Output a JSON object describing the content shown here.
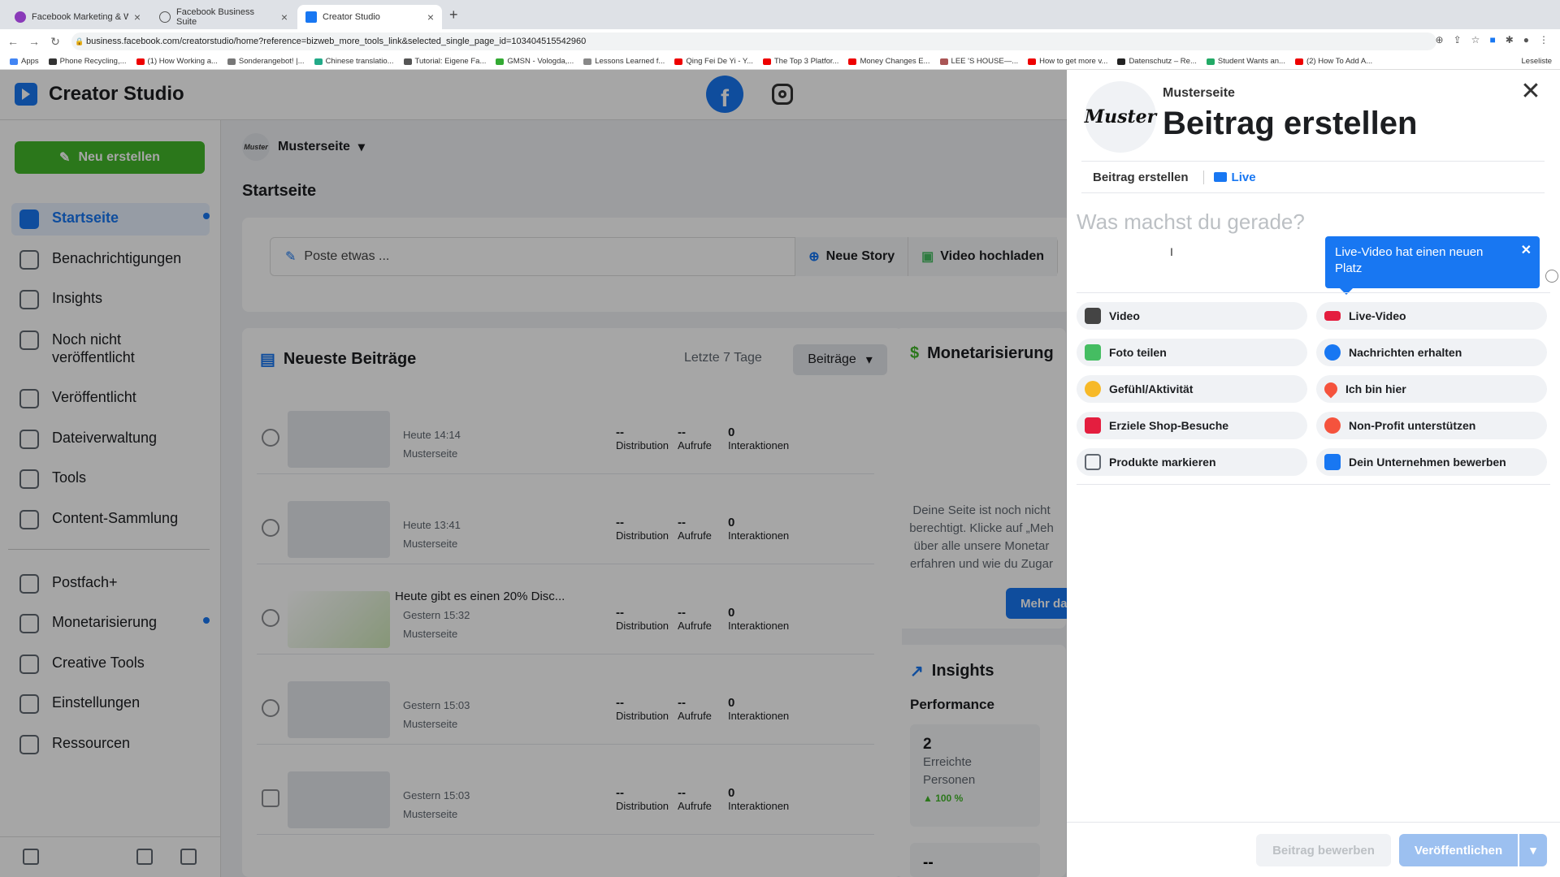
{
  "browser": {
    "tabs": [
      {
        "label": "Facebook Marketing & Werbe...",
        "active": false
      },
      {
        "label": "Facebook Business Suite",
        "active": false
      },
      {
        "label": "Creator Studio",
        "active": true
      }
    ],
    "url": "business.facebook.com/creatorstudio/home?reference=bizweb_more_tools_link&selected_single_page_id=103404515542960",
    "bookmarks": [
      "Apps",
      "Phone Recycling,...",
      "(1) How Working a...",
      "Sonderangebot! |...",
      "Chinese translatio...",
      "Tutorial: Eigene Fa...",
      "GMSN - Vologda,...",
      "Lessons Learned f...",
      "Qing Fei De Yi - Y...",
      "The Top 3 Platfor...",
      "Money Changes E...",
      "LEE 'S HOUSE—...",
      "How to get more v...",
      "Datenschutz – Re...",
      "Student Wants an...",
      "(2) How To Add A..."
    ],
    "reading_list": "Leseliste"
  },
  "app": {
    "name": "Creator Studio",
    "new_button": "Neu erstellen",
    "nav": [
      {
        "label": "Startseite",
        "icon": "home-icon",
        "active": true
      },
      {
        "label": "Benachrichtigungen",
        "icon": "bell-icon"
      },
      {
        "label": "Insights",
        "icon": "chart-line-icon"
      },
      {
        "label": "Noch nicht veröffentlicht",
        "icon": "draft-icon"
      },
      {
        "label": "Veröffentlicht",
        "icon": "list-icon"
      },
      {
        "label": "Dateiverwaltung",
        "icon": "file-icon"
      },
      {
        "label": "Tools",
        "icon": "wrench-icon"
      },
      {
        "label": "Content-Sammlung",
        "icon": "collection-icon"
      },
      {
        "label": "Postfach+",
        "icon": "inbox-icon"
      },
      {
        "label": "Monetarisierung",
        "icon": "dollar-icon"
      },
      {
        "label": "Creative Tools",
        "icon": "creative-icon"
      },
      {
        "label": "Einstellungen",
        "icon": "gear-icon"
      },
      {
        "label": "Ressourcen",
        "icon": "resources-icon"
      }
    ]
  },
  "main": {
    "page_name": "Musterseite",
    "title": "Startseite",
    "post_placeholder": "Poste etwas ...",
    "new_story": "Neue Story",
    "upload_video": "Video hochladen",
    "latest_title": "Neueste Beiträge",
    "period": "Letzte 7 Tage",
    "filter": "Beiträge",
    "stats_labels": {
      "distribution": "Distribution",
      "views": "Aufrufe",
      "interactions": "Interaktionen"
    },
    "posts": [
      {
        "title": "",
        "date": "Heute 14:14",
        "page": "Musterseite",
        "distribution": "--",
        "views": "--",
        "interactions": "0"
      },
      {
        "title": "",
        "date": "Heute 13:41",
        "page": "Musterseite",
        "distribution": "--",
        "views": "--",
        "interactions": "0"
      },
      {
        "title": "Heute gibt es einen 20% Disc...",
        "date": "Gestern 15:32",
        "page": "Musterseite",
        "distribution": "--",
        "views": "--",
        "interactions": "0"
      },
      {
        "title": "",
        "date": "Gestern 15:03",
        "page": "Musterseite",
        "distribution": "--",
        "views": "--",
        "interactions": "0"
      },
      {
        "title": "",
        "date": "Gestern 15:03",
        "page": "Musterseite",
        "distribution": "--",
        "views": "--",
        "interactions": "0"
      }
    ],
    "monetization_title": "Monetarisierung",
    "monetization_text": "Deine Seite ist noch nicht berechtigt. Klicke auf „Meh über alle unsere Monetar erfahren und wie du Zugar",
    "monetization_button": "Mehr da",
    "insights_title": "Insights",
    "performance": "Performance",
    "reach_value": "2",
    "reach_label": "Erreichte Personen",
    "reach_change": "▲ 100 %",
    "bottom_value": "--"
  },
  "panel": {
    "page_name": "Musterseite",
    "avatar_text": "Muster",
    "title": "Beitrag erstellen",
    "tab_create": "Beitrag erstellen",
    "tab_live": "Live",
    "placeholder": "Was machst du gerade?",
    "tooltip": "Live-Video hat einen neuen Platz",
    "options": [
      {
        "label": "Video",
        "icon": "video-clapper-icon",
        "color": "#444444"
      },
      {
        "label": "Live-Video",
        "icon": "live-badge-icon",
        "color": "#e41e3f"
      },
      {
        "label": "Foto teilen",
        "icon": "photo-icon",
        "color": "#45bd62"
      },
      {
        "label": "Nachrichten erhalten",
        "icon": "messenger-icon",
        "color": "#1877f2"
      },
      {
        "label": "Gefühl/Aktivität",
        "icon": "smiley-icon",
        "color": "#f7b928"
      },
      {
        "label": "Ich bin hier",
        "icon": "location-pin-icon",
        "color": "#f5533d"
      },
      {
        "label": "Erziele Shop-Besuche",
        "icon": "shopping-bag-icon",
        "color": "#e41e3f"
      },
      {
        "label": "Non-Profit unterstützen",
        "icon": "heart-icon",
        "color": "#f5533d"
      },
      {
        "label": "Produkte markieren",
        "icon": "product-tag-icon",
        "color": "#606770"
      },
      {
        "label": "Dein Unternehmen bewerben",
        "icon": "promote-icon",
        "color": "#1877f2"
      }
    ],
    "boost_button": "Beitrag bewerben",
    "publish_button": "Veröffentlichen"
  }
}
